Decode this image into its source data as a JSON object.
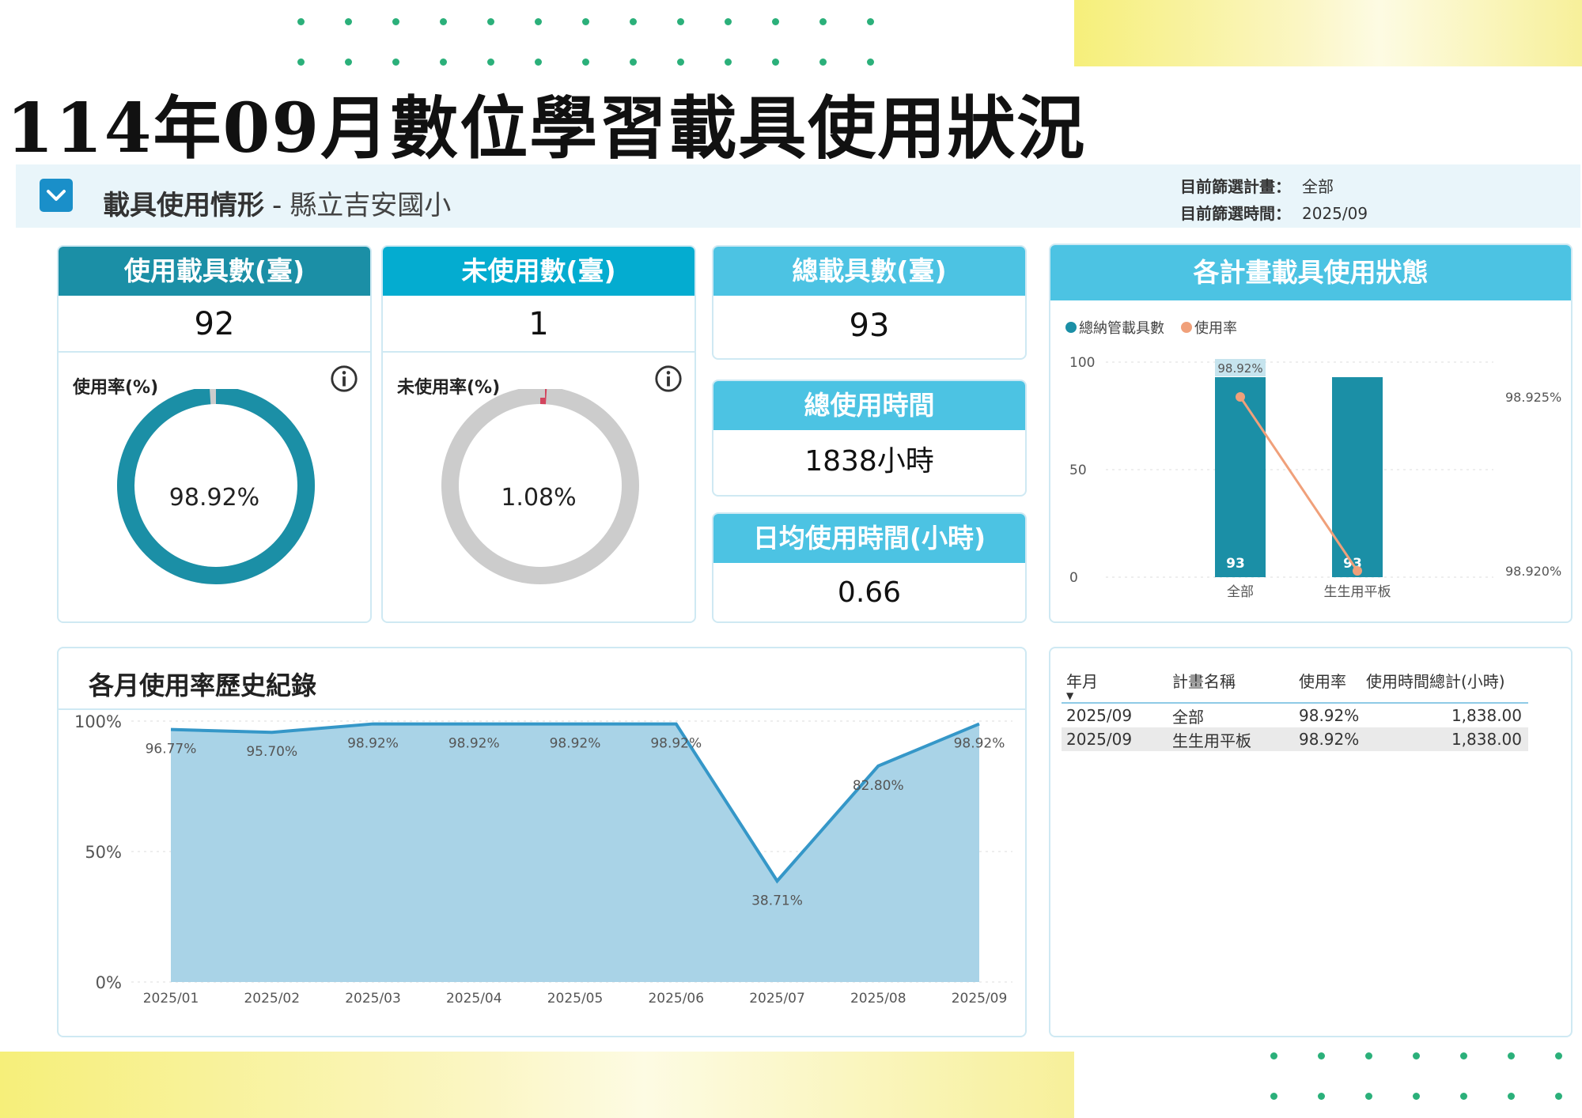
{
  "page": {
    "title": "114年09月數位學習載具使用狀況"
  },
  "header": {
    "title": "載具使用情形",
    "separator": "-",
    "school": "縣立吉安國小",
    "filter_plan_label": "目前篩選計畫：",
    "filter_plan_value": "全部",
    "filter_time_label": "目前篩選時間：",
    "filter_time_value": "2025/09"
  },
  "cards": {
    "used": {
      "title": "使用載具數(臺)",
      "value": "92",
      "rate_label": "使用率(%)",
      "rate_value": "98.92%",
      "rate": 98.92
    },
    "unused": {
      "title": "未使用數(臺)",
      "value": "1",
      "rate_label": "未使用率(%)",
      "rate_value": "1.08%",
      "rate": 1.08
    },
    "total": {
      "title": "總載具數(臺)",
      "value": "93"
    },
    "total_time": {
      "title": "總使用時間",
      "value": "1838小時"
    },
    "daily_avg": {
      "title": "日均使用時間(小時)",
      "value": "0.66"
    }
  },
  "colors": {
    "teal_dark": "#1b8fa6",
    "teal_light": "#4cc3e3",
    "cyan": "#04acd0",
    "rate_line": "#f0a07a",
    "area_fill": "#a9d3e7",
    "area_line": "#3597c8",
    "gauge_grey": "#cccccc",
    "gauge_red": "#d3455e"
  },
  "chart_data": [
    {
      "type": "bar",
      "title": "各計畫載具使用狀態",
      "legend": [
        "總納管載具數",
        "使用率"
      ],
      "legend_position": "top-left",
      "categories": [
        "全部",
        "生生用平板"
      ],
      "series": [
        {
          "name": "總納管載具數",
          "type": "bar",
          "values": [
            93,
            93
          ],
          "data_labels": [
            "93",
            "93"
          ]
        },
        {
          "name": "使用率",
          "type": "line",
          "values": [
            98.92,
            98.92
          ]
        }
      ],
      "top_label": "98.92%",
      "ylim": [
        0,
        100
      ],
      "yticks": [
        "100",
        "50",
        "0"
      ],
      "y2ticks": [
        "98.925%",
        "98.920%"
      ],
      "grid": true
    },
    {
      "type": "area",
      "title": "各月使用率歷史紀錄",
      "x": [
        "2025/01",
        "2025/02",
        "2025/03",
        "2025/04",
        "2025/05",
        "2025/06",
        "2025/07",
        "2025/08",
        "2025/09"
      ],
      "values": [
        96.77,
        95.7,
        98.92,
        98.92,
        98.92,
        98.92,
        38.71,
        82.8,
        98.92
      ],
      "labels": [
        "96.77%",
        "95.70%",
        "98.92%",
        "98.92%",
        "98.92%",
        "98.92%",
        "38.71%",
        "82.80%",
        "98.92%"
      ],
      "yticks": [
        "100%",
        "50%",
        "0%"
      ],
      "ylim": [
        0,
        100
      ],
      "grid": true
    }
  ],
  "table": {
    "columns": [
      "年月",
      "計畫名稱",
      "使用率",
      "使用時間總計(小時)"
    ],
    "rows": [
      [
        "2025/09",
        "全部",
        "98.92%",
        "1,838.00"
      ],
      [
        "2025/09",
        "生生用平板",
        "98.92%",
        "1,838.00"
      ]
    ]
  }
}
